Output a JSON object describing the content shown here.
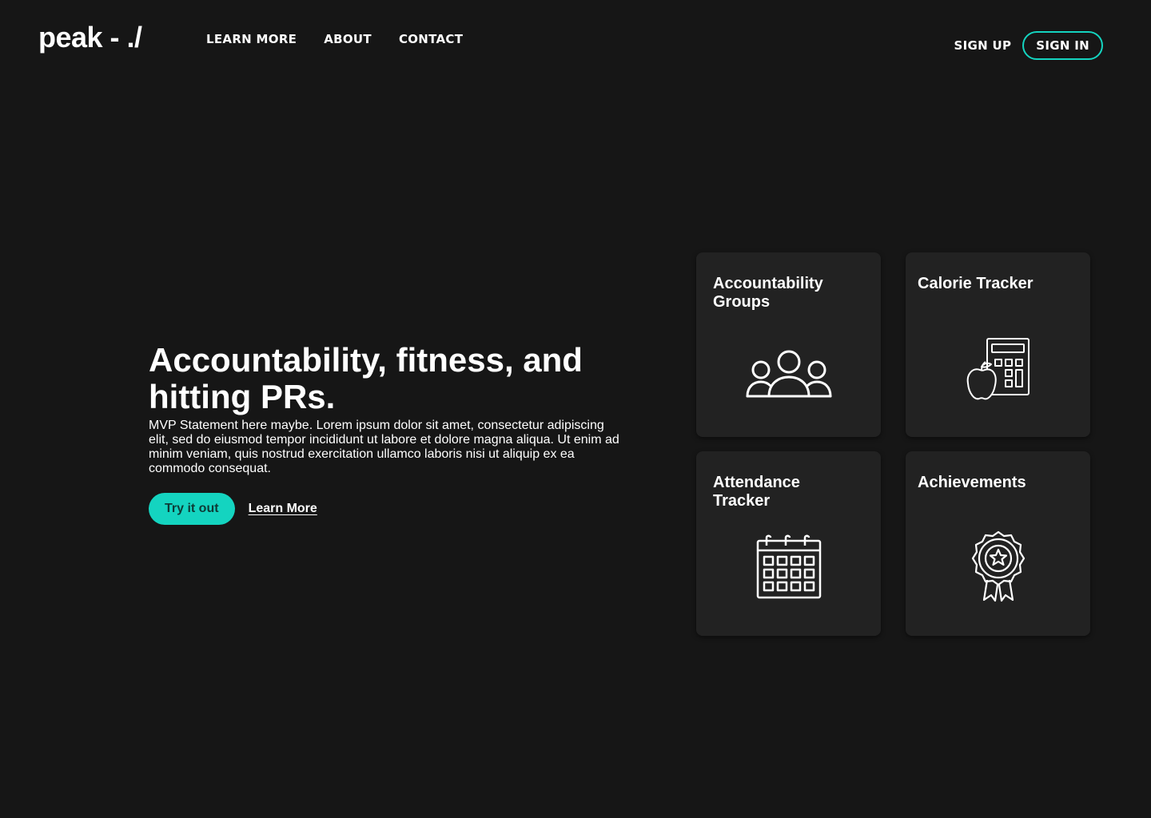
{
  "brand": {
    "logo": "peak - ./"
  },
  "nav": {
    "items": [
      "LEARN MORE",
      "ABOUT",
      "CONTACT"
    ]
  },
  "auth": {
    "sign_up": "SIGN UP",
    "sign_in": "SIGN IN"
  },
  "hero": {
    "headline": "Accountability, fitness, and hitting PRs.",
    "statement": "MVP Statement here maybe. Lorem ipsum dolor sit amet, consectetur adipiscing elit, sed do eiusmod tempor incididunt ut labore et dolore magna aliqua. Ut enim ad minim veniam, quis nostrud exercitation ullamco laboris nisi ut aliquip ex ea commodo consequat.",
    "primary_cta": "Try it out",
    "secondary_cta": "Learn More"
  },
  "features": [
    {
      "title": "Accountability Groups",
      "icon": "group-icon"
    },
    {
      "title": "Calorie Tracker",
      "icon": "calculator-apple-icon"
    },
    {
      "title": "Attendance Tracker",
      "icon": "calendar-icon"
    },
    {
      "title": "Achievements",
      "icon": "award-badge-icon"
    }
  ],
  "colors": {
    "background": "#161616",
    "card": "#222222",
    "accent": "#14d4c0",
    "text": "#ffffff"
  }
}
